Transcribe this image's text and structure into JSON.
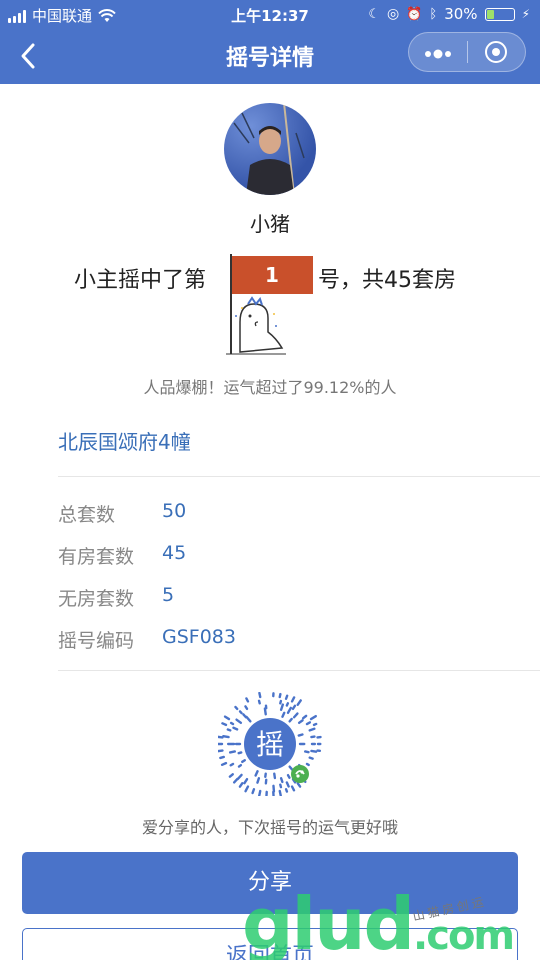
{
  "status_bar": {
    "carrier": "中国联通",
    "time": "上午12:37",
    "battery_text": "30%",
    "battery_level": 0.3
  },
  "nav": {
    "title": "摇号详情",
    "back_icon": "chevron-left-icon",
    "more_icon": "more-dots-icon",
    "close_icon": "target-icon"
  },
  "user": {
    "nickname": "小猪"
  },
  "result": {
    "prefix": "小主摇中了第",
    "number": "1",
    "suffix": "号，共45套房"
  },
  "luck_text": "人品爆棚！运气超过了99.12%的人",
  "project_name": "北辰国颂府4幢",
  "info": [
    {
      "label": "总套数",
      "value": "50"
    },
    {
      "label": "有房套数",
      "value": "45"
    },
    {
      "label": "无房套数",
      "value": "5"
    },
    {
      "label": "摇号编码",
      "value": "GSF083"
    }
  ],
  "qr": {
    "center_char": "摇"
  },
  "share_tip": "爱分享的人，下次摇号的运气更好哦",
  "buttons": {
    "share": "分享",
    "home": "返回首页"
  },
  "watermark": {
    "main_g": "g",
    "main_lu": "lu",
    "main_d": "d",
    "main_com": ".com",
    "sub": "山猫房创运"
  },
  "colors": {
    "primary": "#4a73c9",
    "link": "#3a6fb8",
    "flag": "#c9502b"
  }
}
